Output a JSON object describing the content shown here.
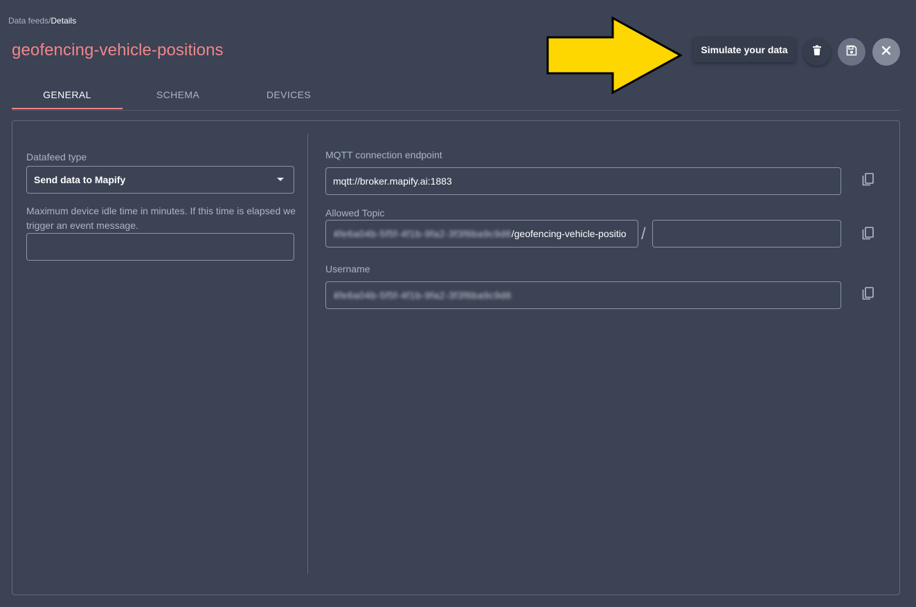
{
  "breadcrumb": {
    "parent": "Data feeds",
    "separator": "/",
    "current": "Details"
  },
  "page_title": "geofencing-vehicle-positions",
  "actions": {
    "tooltip": "Simulate your data",
    "delete_icon": "trash-icon",
    "save_icon": "save-icon",
    "close_icon": "close-icon"
  },
  "tabs": [
    {
      "label": "GENERAL",
      "active": true
    },
    {
      "label": "SCHEMA",
      "active": false
    },
    {
      "label": "DEVICES",
      "active": false
    }
  ],
  "general": {
    "datafeed_type_label": "Datafeed type",
    "datafeed_type_value": "Send data to Mapify",
    "idle_time_helper": "Maximum device idle time in minutes. If this time is elapsed we trigger an event message.",
    "idle_time_value": "",
    "mqtt_label": "MQTT connection endpoint",
    "mqtt_value": "mqtt://broker.mapify.ai:1883",
    "topic_label": "Allowed Topic",
    "topic_prefix_blurred": "4fe6a04b-5f5f-4f1b-9fa2-3f3f6ba9c9d6",
    "topic_suffix": "/geofencing-vehicle-positio",
    "topic_separator": "/",
    "topic_extra_value": "",
    "username_label": "Username",
    "username_blurred": "4fe6a04b-5f5f-4f1b-9fa2-3f3f6ba9c9d6"
  },
  "colors": {
    "background": "#3b4355",
    "accent": "#f2868a",
    "arrow": "#ffd700"
  }
}
